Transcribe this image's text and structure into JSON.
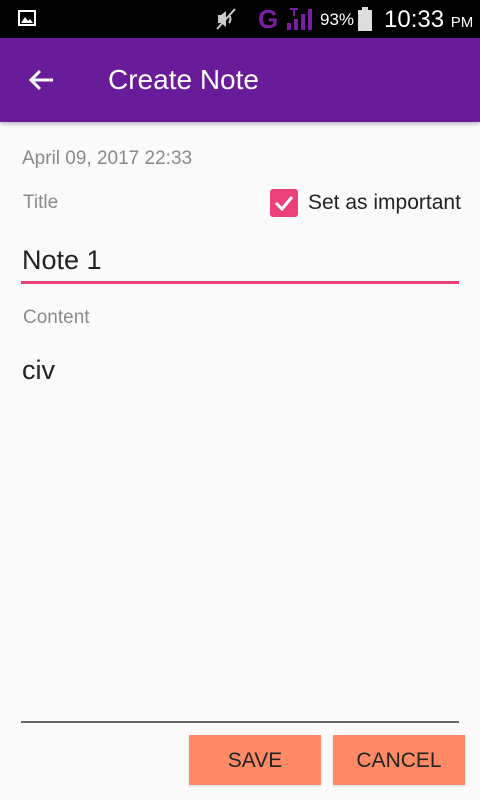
{
  "status_bar": {
    "network_type": "G",
    "battery_percent": "93%",
    "time": "10:33",
    "ampm": "PM",
    "icons": [
      "gallery-icon",
      "mute-icon",
      "signal-icon",
      "battery-icon"
    ]
  },
  "app_bar": {
    "title": "Create Note",
    "back_icon": "arrow-back-icon",
    "color": "#6a1b9a"
  },
  "form": {
    "date": "April 09, 2017 22:33",
    "title_label": "Title",
    "important_label": "Set as important",
    "important_checked": true,
    "title_value": "Note 1",
    "content_label": "Content",
    "content_value": "civ"
  },
  "buttons": {
    "save": "SAVE",
    "cancel": "CANCEL",
    "color": "#ff8a65"
  },
  "accent_color": "#ec407a"
}
